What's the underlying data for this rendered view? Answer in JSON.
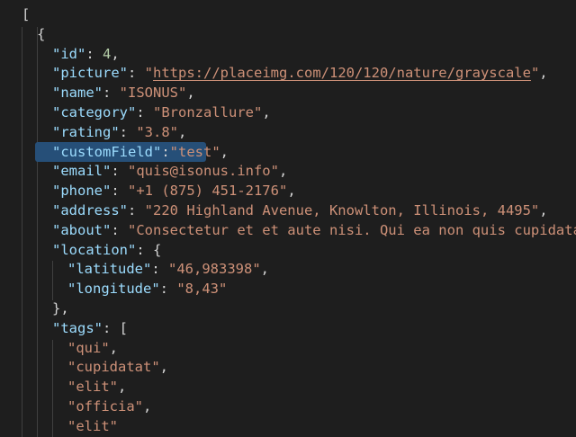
{
  "editor": {
    "top_fragment": "·····················",
    "lines": [
      {
        "indent": 0,
        "tokens": [
          {
            "t": "p",
            "v": "["
          }
        ]
      },
      {
        "indent": 1,
        "tokens": [
          {
            "t": "p",
            "v": "{"
          }
        ]
      },
      {
        "indent": 2,
        "tokens": [
          {
            "t": "k",
            "v": "\"id\""
          },
          {
            "t": "p",
            "v": ": "
          },
          {
            "t": "n",
            "v": "4"
          },
          {
            "t": "p",
            "v": ","
          }
        ]
      },
      {
        "indent": 2,
        "tokens": [
          {
            "t": "k",
            "v": "\"picture\""
          },
          {
            "t": "p",
            "v": ": "
          },
          {
            "t": "s",
            "v": "\""
          },
          {
            "t": "u",
            "v": "https://placeimg.com/120/120/nature/grayscale"
          },
          {
            "t": "s",
            "v": "\""
          },
          {
            "t": "p",
            "v": ","
          }
        ]
      },
      {
        "indent": 2,
        "tokens": [
          {
            "t": "k",
            "v": "\"name\""
          },
          {
            "t": "p",
            "v": ": "
          },
          {
            "t": "s",
            "v": "\"ISONUS\""
          },
          {
            "t": "p",
            "v": ","
          }
        ]
      },
      {
        "indent": 2,
        "tokens": [
          {
            "t": "k",
            "v": "\"category\""
          },
          {
            "t": "p",
            "v": ": "
          },
          {
            "t": "s",
            "v": "\"Bronzallure\""
          },
          {
            "t": "p",
            "v": ","
          }
        ]
      },
      {
        "indent": 2,
        "tokens": [
          {
            "t": "k",
            "v": "\"rating\""
          },
          {
            "t": "p",
            "v": ": "
          },
          {
            "t": "s",
            "v": "\"3.8\""
          },
          {
            "t": "p",
            "v": ","
          }
        ]
      },
      {
        "indent": 2,
        "selected": true,
        "tokens": [
          {
            "t": "k",
            "v": "\"customField\""
          },
          {
            "t": "p",
            "v": ":"
          },
          {
            "t": "s",
            "v": "\"test\""
          },
          {
            "t": "p",
            "v": ","
          }
        ]
      },
      {
        "indent": 2,
        "tokens": [
          {
            "t": "k",
            "v": "\"email\""
          },
          {
            "t": "p",
            "v": ": "
          },
          {
            "t": "s",
            "v": "\"quis@isonus.info\""
          },
          {
            "t": "p",
            "v": ","
          }
        ]
      },
      {
        "indent": 2,
        "tokens": [
          {
            "t": "k",
            "v": "\"phone\""
          },
          {
            "t": "p",
            "v": ": "
          },
          {
            "t": "s",
            "v": "\"+1 (875) 451-2176\""
          },
          {
            "t": "p",
            "v": ","
          }
        ]
      },
      {
        "indent": 2,
        "tokens": [
          {
            "t": "k",
            "v": "\"address\""
          },
          {
            "t": "p",
            "v": ": "
          },
          {
            "t": "s",
            "v": "\"220 Highland Avenue, Knowlton, Illinois, 4495\""
          },
          {
            "t": "p",
            "v": ","
          }
        ]
      },
      {
        "indent": 2,
        "tokens": [
          {
            "t": "k",
            "v": "\"about\""
          },
          {
            "t": "p",
            "v": ": "
          },
          {
            "t": "s",
            "v": "\"Consectetur et et aute nisi. Qui ea non quis cupidatat sit"
          }
        ]
      },
      {
        "indent": 2,
        "tokens": [
          {
            "t": "k",
            "v": "\"location\""
          },
          {
            "t": "p",
            "v": ": {"
          }
        ]
      },
      {
        "indent": 3,
        "tokens": [
          {
            "t": "k",
            "v": "\"latitude\""
          },
          {
            "t": "p",
            "v": ": "
          },
          {
            "t": "s",
            "v": "\"46,983398\""
          },
          {
            "t": "p",
            "v": ","
          }
        ]
      },
      {
        "indent": 3,
        "tokens": [
          {
            "t": "k",
            "v": "\"longitude\""
          },
          {
            "t": "p",
            "v": ": "
          },
          {
            "t": "s",
            "v": "\"8,43\""
          }
        ]
      },
      {
        "indent": 2,
        "tokens": [
          {
            "t": "p",
            "v": "},"
          }
        ]
      },
      {
        "indent": 2,
        "tokens": [
          {
            "t": "k",
            "v": "\"tags\""
          },
          {
            "t": "p",
            "v": ": ["
          }
        ]
      },
      {
        "indent": 3,
        "tokens": [
          {
            "t": "s",
            "v": "\"qui\""
          },
          {
            "t": "p",
            "v": ","
          }
        ]
      },
      {
        "indent": 3,
        "tokens": [
          {
            "t": "s",
            "v": "\"cupidatat\""
          },
          {
            "t": "p",
            "v": ","
          }
        ]
      },
      {
        "indent": 3,
        "tokens": [
          {
            "t": "s",
            "v": "\"elit\""
          },
          {
            "t": "p",
            "v": ","
          }
        ]
      },
      {
        "indent": 3,
        "tokens": [
          {
            "t": "s",
            "v": "\"officia\""
          },
          {
            "t": "p",
            "v": ","
          }
        ]
      },
      {
        "indent": 3,
        "tokens": [
          {
            "t": "s",
            "v": "\"elit\""
          }
        ]
      }
    ]
  },
  "colors": {
    "background": "#1e1e1e",
    "key": "#9cdcfe",
    "string": "#ce9178",
    "number": "#b5cea8",
    "punctuation": "#d4d4d4",
    "selection": "#264f78"
  }
}
